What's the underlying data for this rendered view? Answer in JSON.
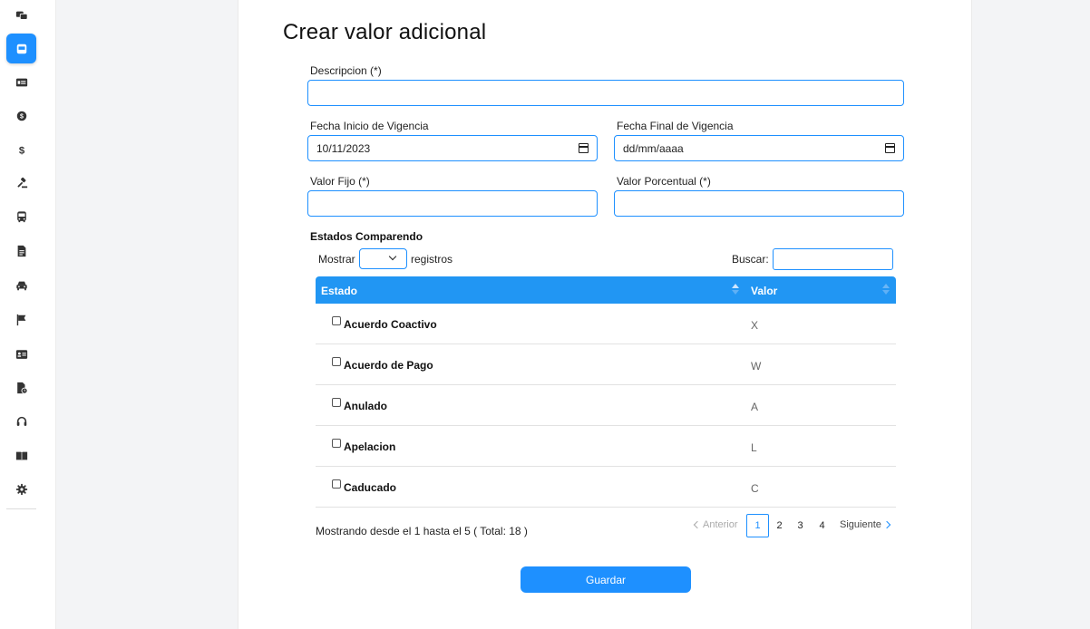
{
  "sidebar": {
    "items": [
      {
        "icon": "chat-bubbles-icon"
      },
      {
        "icon": "inbox-icon",
        "active": true
      },
      {
        "icon": "list-card-icon"
      },
      {
        "icon": "coin-icon"
      },
      {
        "icon": "dollar-icon"
      },
      {
        "icon": "gavel-icon"
      },
      {
        "icon": "bus-icon"
      },
      {
        "icon": "document-icon"
      },
      {
        "icon": "car-icon"
      },
      {
        "icon": "flag-icon"
      },
      {
        "icon": "id-card-icon"
      },
      {
        "icon": "file-clock-icon"
      },
      {
        "icon": "headset-icon"
      },
      {
        "icon": "book-icon"
      },
      {
        "icon": "gear-icon"
      }
    ],
    "accent": "#1e90ff"
  },
  "form": {
    "title": "Crear valor adicional",
    "descripcion": {
      "label": "Descripcion (*)",
      "value": ""
    },
    "fecha_inicio": {
      "label": "Fecha Inicio de Vigencia",
      "value": "10/11/2023"
    },
    "fecha_final": {
      "label": "Fecha Final de Vigencia",
      "value": "dd/mm/aaaa"
    },
    "valor_fijo": {
      "label": "Valor Fijo (*)",
      "value": ""
    },
    "valor_porcentual": {
      "label": "Valor Porcentual (*)",
      "value": ""
    },
    "save_label": "Guardar"
  },
  "table": {
    "section_title": "Estados Comparendo",
    "show_label": "Mostrar",
    "records_label": "registros",
    "search_label": "Buscar:",
    "search_value": "",
    "headers": {
      "estado": "Estado",
      "valor": "Valor"
    },
    "rows": [
      {
        "estado": "Acuerdo Coactivo",
        "valor": "X",
        "checked": false
      },
      {
        "estado": "Acuerdo de Pago",
        "valor": "W",
        "checked": false
      },
      {
        "estado": "Anulado",
        "valor": "A",
        "checked": false
      },
      {
        "estado": "Apelacion",
        "valor": "L",
        "checked": false
      },
      {
        "estado": "Caducado",
        "valor": "C",
        "checked": false
      }
    ],
    "info": "Mostrando desde el 1 hasta el 5 ( Total: 18 )",
    "pagination": {
      "prev": "Anterior",
      "pages": [
        "1",
        "2",
        "3",
        "4"
      ],
      "current": "1",
      "next": "Siguiente"
    },
    "header_color": "#2196f3"
  }
}
